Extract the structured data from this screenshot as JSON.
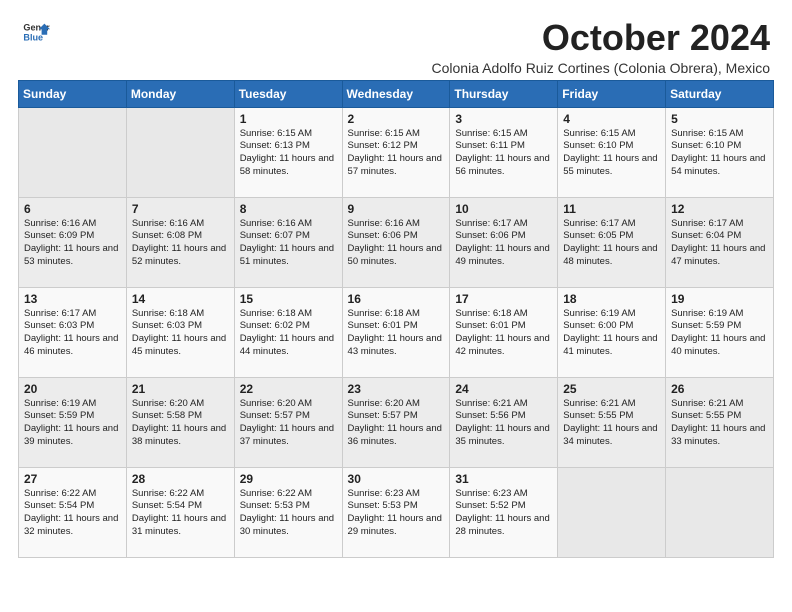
{
  "logo": {
    "line1": "General",
    "line2": "Blue"
  },
  "header": {
    "month": "October 2024",
    "location": "Colonia Adolfo Ruiz Cortines (Colonia Obrera), Mexico"
  },
  "days_of_week": [
    "Sunday",
    "Monday",
    "Tuesday",
    "Wednesday",
    "Thursday",
    "Friday",
    "Saturday"
  ],
  "weeks": [
    [
      {
        "day": "",
        "text": ""
      },
      {
        "day": "",
        "text": ""
      },
      {
        "day": "1",
        "text": "Sunrise: 6:15 AM\nSunset: 6:13 PM\nDaylight: 11 hours and 58 minutes."
      },
      {
        "day": "2",
        "text": "Sunrise: 6:15 AM\nSunset: 6:12 PM\nDaylight: 11 hours and 57 minutes."
      },
      {
        "day": "3",
        "text": "Sunrise: 6:15 AM\nSunset: 6:11 PM\nDaylight: 11 hours and 56 minutes."
      },
      {
        "day": "4",
        "text": "Sunrise: 6:15 AM\nSunset: 6:10 PM\nDaylight: 11 hours and 55 minutes."
      },
      {
        "day": "5",
        "text": "Sunrise: 6:15 AM\nSunset: 6:10 PM\nDaylight: 11 hours and 54 minutes."
      }
    ],
    [
      {
        "day": "6",
        "text": "Sunrise: 6:16 AM\nSunset: 6:09 PM\nDaylight: 11 hours and 53 minutes."
      },
      {
        "day": "7",
        "text": "Sunrise: 6:16 AM\nSunset: 6:08 PM\nDaylight: 11 hours and 52 minutes."
      },
      {
        "day": "8",
        "text": "Sunrise: 6:16 AM\nSunset: 6:07 PM\nDaylight: 11 hours and 51 minutes."
      },
      {
        "day": "9",
        "text": "Sunrise: 6:16 AM\nSunset: 6:06 PM\nDaylight: 11 hours and 50 minutes."
      },
      {
        "day": "10",
        "text": "Sunrise: 6:17 AM\nSunset: 6:06 PM\nDaylight: 11 hours and 49 minutes."
      },
      {
        "day": "11",
        "text": "Sunrise: 6:17 AM\nSunset: 6:05 PM\nDaylight: 11 hours and 48 minutes."
      },
      {
        "day": "12",
        "text": "Sunrise: 6:17 AM\nSunset: 6:04 PM\nDaylight: 11 hours and 47 minutes."
      }
    ],
    [
      {
        "day": "13",
        "text": "Sunrise: 6:17 AM\nSunset: 6:03 PM\nDaylight: 11 hours and 46 minutes."
      },
      {
        "day": "14",
        "text": "Sunrise: 6:18 AM\nSunset: 6:03 PM\nDaylight: 11 hours and 45 minutes."
      },
      {
        "day": "15",
        "text": "Sunrise: 6:18 AM\nSunset: 6:02 PM\nDaylight: 11 hours and 44 minutes."
      },
      {
        "day": "16",
        "text": "Sunrise: 6:18 AM\nSunset: 6:01 PM\nDaylight: 11 hours and 43 minutes."
      },
      {
        "day": "17",
        "text": "Sunrise: 6:18 AM\nSunset: 6:01 PM\nDaylight: 11 hours and 42 minutes."
      },
      {
        "day": "18",
        "text": "Sunrise: 6:19 AM\nSunset: 6:00 PM\nDaylight: 11 hours and 41 minutes."
      },
      {
        "day": "19",
        "text": "Sunrise: 6:19 AM\nSunset: 5:59 PM\nDaylight: 11 hours and 40 minutes."
      }
    ],
    [
      {
        "day": "20",
        "text": "Sunrise: 6:19 AM\nSunset: 5:59 PM\nDaylight: 11 hours and 39 minutes."
      },
      {
        "day": "21",
        "text": "Sunrise: 6:20 AM\nSunset: 5:58 PM\nDaylight: 11 hours and 38 minutes."
      },
      {
        "day": "22",
        "text": "Sunrise: 6:20 AM\nSunset: 5:57 PM\nDaylight: 11 hours and 37 minutes."
      },
      {
        "day": "23",
        "text": "Sunrise: 6:20 AM\nSunset: 5:57 PM\nDaylight: 11 hours and 36 minutes."
      },
      {
        "day": "24",
        "text": "Sunrise: 6:21 AM\nSunset: 5:56 PM\nDaylight: 11 hours and 35 minutes."
      },
      {
        "day": "25",
        "text": "Sunrise: 6:21 AM\nSunset: 5:55 PM\nDaylight: 11 hours and 34 minutes."
      },
      {
        "day": "26",
        "text": "Sunrise: 6:21 AM\nSunset: 5:55 PM\nDaylight: 11 hours and 33 minutes."
      }
    ],
    [
      {
        "day": "27",
        "text": "Sunrise: 6:22 AM\nSunset: 5:54 PM\nDaylight: 11 hours and 32 minutes."
      },
      {
        "day": "28",
        "text": "Sunrise: 6:22 AM\nSunset: 5:54 PM\nDaylight: 11 hours and 31 minutes."
      },
      {
        "day": "29",
        "text": "Sunrise: 6:22 AM\nSunset: 5:53 PM\nDaylight: 11 hours and 30 minutes."
      },
      {
        "day": "30",
        "text": "Sunrise: 6:23 AM\nSunset: 5:53 PM\nDaylight: 11 hours and 29 minutes."
      },
      {
        "day": "31",
        "text": "Sunrise: 6:23 AM\nSunset: 5:52 PM\nDaylight: 11 hours and 28 minutes."
      },
      {
        "day": "",
        "text": ""
      },
      {
        "day": "",
        "text": ""
      }
    ]
  ]
}
